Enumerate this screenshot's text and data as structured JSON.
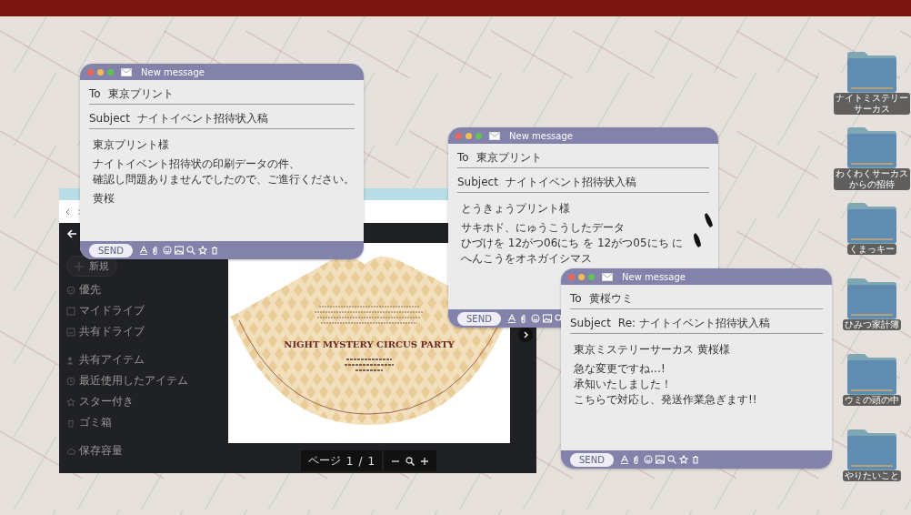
{
  "viewer": {
    "new_button": "新規",
    "sidebar": [
      {
        "label": "優先"
      },
      {
        "label": "マイドライブ"
      },
      {
        "label": "共有ドライブ"
      },
      {
        "label": "共有アイテム"
      },
      {
        "label": "最近使用したアイテム"
      },
      {
        "label": "スター付き"
      },
      {
        "label": "ゴミ箱"
      },
      {
        "label": "保存容量"
      }
    ],
    "document": {
      "title": "NIGHT MYSTERY CIRCUS PARTY"
    },
    "pager": {
      "label": "ページ",
      "current": "1",
      "separator": "/",
      "total": "1"
    }
  },
  "windows": [
    {
      "title": "New message",
      "to_label": "To",
      "to": "東京プリント",
      "subject_label": "Subject",
      "subject": "ナイトイベント招待状入稿",
      "body": [
        [
          "東京プリント様"
        ],
        [
          "ナイトイベント招待状の印刷データの件、",
          "確認し問題ありませんでしたので、ご進行ください。"
        ],
        [
          "黄桜"
        ]
      ],
      "send": "SEND"
    },
    {
      "title": "New message",
      "to_label": "To",
      "to": "東京プリント",
      "subject_label": "Subject",
      "subject": "ナイトイベント招待状入稿",
      "body": [
        [
          "とうきょうプリント様"
        ],
        [
          "サキホド、にゅうこうしたデータ",
          "ひづけを 12がつ06にち を 12がつ05にち に",
          "へんこうをオネガイシマス"
        ]
      ],
      "send": "SEND"
    },
    {
      "title": "New message",
      "to_label": "To",
      "to": "黄桜ウミ",
      "subject_label": "Subject",
      "subject": "Re: ナイトイベント招待状入稿",
      "body": [
        [
          "東京ミステリーサーカス 黄桜様"
        ],
        [
          "急な変更ですね…!",
          "承知いたしました！",
          "こちらで対応し、発送作業急ぎます!!"
        ]
      ],
      "send": "SEND"
    }
  ],
  "folders": [
    {
      "label": "ナイトミステリーサーカス"
    },
    {
      "label": "わくわくサーカスからの招待"
    },
    {
      "label": "くまっキー"
    },
    {
      "label": "ひみつ家計簿"
    },
    {
      "label": "ウミの頭の中"
    },
    {
      "label": "やりたいこと"
    }
  ]
}
